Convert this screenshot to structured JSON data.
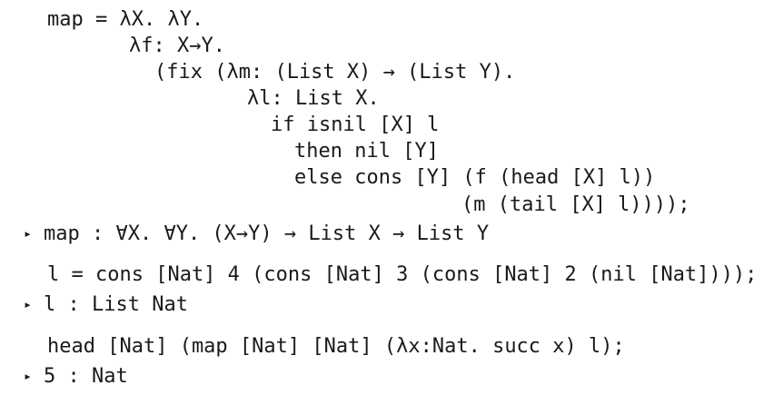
{
  "lines": [
    {
      "text": "map = λX. λY."
    },
    {
      "text": "λf: X→Y."
    },
    {
      "text": "(fix (λm: (List X) → (List Y)."
    },
    {
      "text": "λl: List X."
    },
    {
      "text": "if isnil [X] l"
    },
    {
      "text": "then nil [Y]"
    },
    {
      "text": "else cons [Y] (f (head [X] l))"
    },
    {
      "text": "(m (tail [X] l))));"
    },
    {
      "marker": "▸",
      "text": "map : ∀X. ∀Y. (X→Y) → List X → List Y"
    },
    {
      "text": "l = cons [Nat] 4 (cons [Nat] 3 (cons [Nat] 2 (nil [Nat])));"
    },
    {
      "marker": "▸",
      "text": "l : List Nat"
    },
    {
      "text": "head [Nat] (map [Nat] [Nat] (λx:Nat. succ x) l);"
    },
    {
      "marker": "▸",
      "text": "5 : Nat"
    }
  ]
}
